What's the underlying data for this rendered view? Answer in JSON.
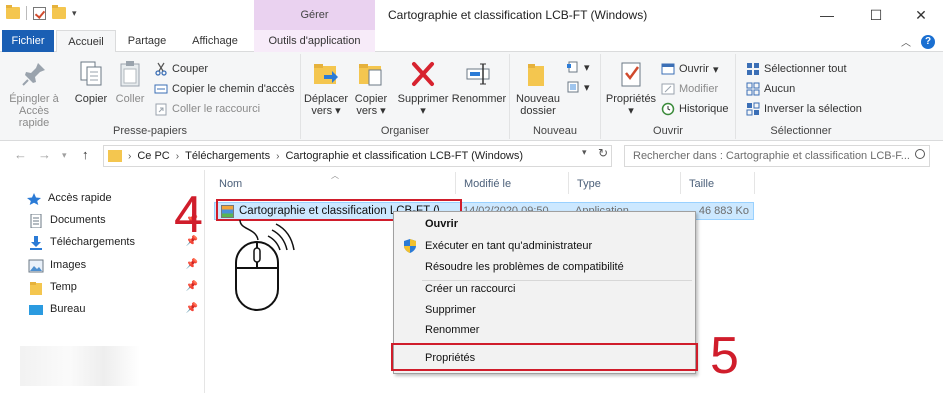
{
  "window": {
    "title": "Cartographie et classification LCB-FT (Windows)",
    "contextual_tab_group": "Gérer"
  },
  "tabs": {
    "fichier": "Fichier",
    "accueil": "Accueil",
    "partage": "Partage",
    "affichage": "Affichage",
    "outils": "Outils d'application"
  },
  "ribbon": {
    "presse_papiers": {
      "label": "Presse-papiers",
      "epingler": "Épingler à Accès rapide",
      "copier": "Copier",
      "coller": "Coller",
      "couper": "Couper",
      "copier_chemin": "Copier le chemin d'accès",
      "coller_raccourci": "Coller le raccourci"
    },
    "organiser": {
      "label": "Organiser",
      "deplacer": "Déplacer vers",
      "copier_vers": "Copier vers",
      "supprimer": "Supprimer",
      "renommer": "Renommer"
    },
    "nouveau": {
      "label": "Nouveau",
      "nouveau_dossier": "Nouveau dossier"
    },
    "ouvrir": {
      "label": "Ouvrir",
      "proprietes": "Propriétés",
      "ouvrir": "Ouvrir",
      "modifier": "Modifier",
      "historique": "Historique"
    },
    "selectionner": {
      "label": "Sélectionner",
      "tout": "Sélectionner tout",
      "aucun": "Aucun",
      "inverser": "Inverser la sélection"
    }
  },
  "address": {
    "crumbs": [
      "Ce PC",
      "Téléchargements",
      "Cartographie et classification LCB-FT (Windows)"
    ],
    "search_placeholder": "Rechercher dans : Cartographie et classification LCB-F..."
  },
  "sidebar": {
    "items": [
      {
        "label": "Accès rapide"
      },
      {
        "label": "Documents"
      },
      {
        "label": "Téléchargements"
      },
      {
        "label": "Images"
      },
      {
        "label": "Temp"
      },
      {
        "label": "Bureau"
      }
    ]
  },
  "columns": {
    "nom": "Nom",
    "modifie": "Modifié le",
    "type": "Type",
    "taille": "Taille"
  },
  "file": {
    "name": "Cartographie et classification LCB-FT (Wi",
    "date": "14/02/2020 09:50",
    "type": "Application",
    "size": "46 883 Ko"
  },
  "context_menu": {
    "items": [
      "Ouvrir",
      "Exécuter en tant qu'administrateur",
      "Résoudre les problèmes de compatibilité",
      "Créer un raccourci",
      "Supprimer",
      "Renommer",
      "Propriétés"
    ]
  },
  "annotations": {
    "step_4": "4",
    "step_5": "5"
  },
  "colors": {
    "accent": "#1a5fb4",
    "highlight": "#d01d2b",
    "selection": "#cce8ff"
  }
}
